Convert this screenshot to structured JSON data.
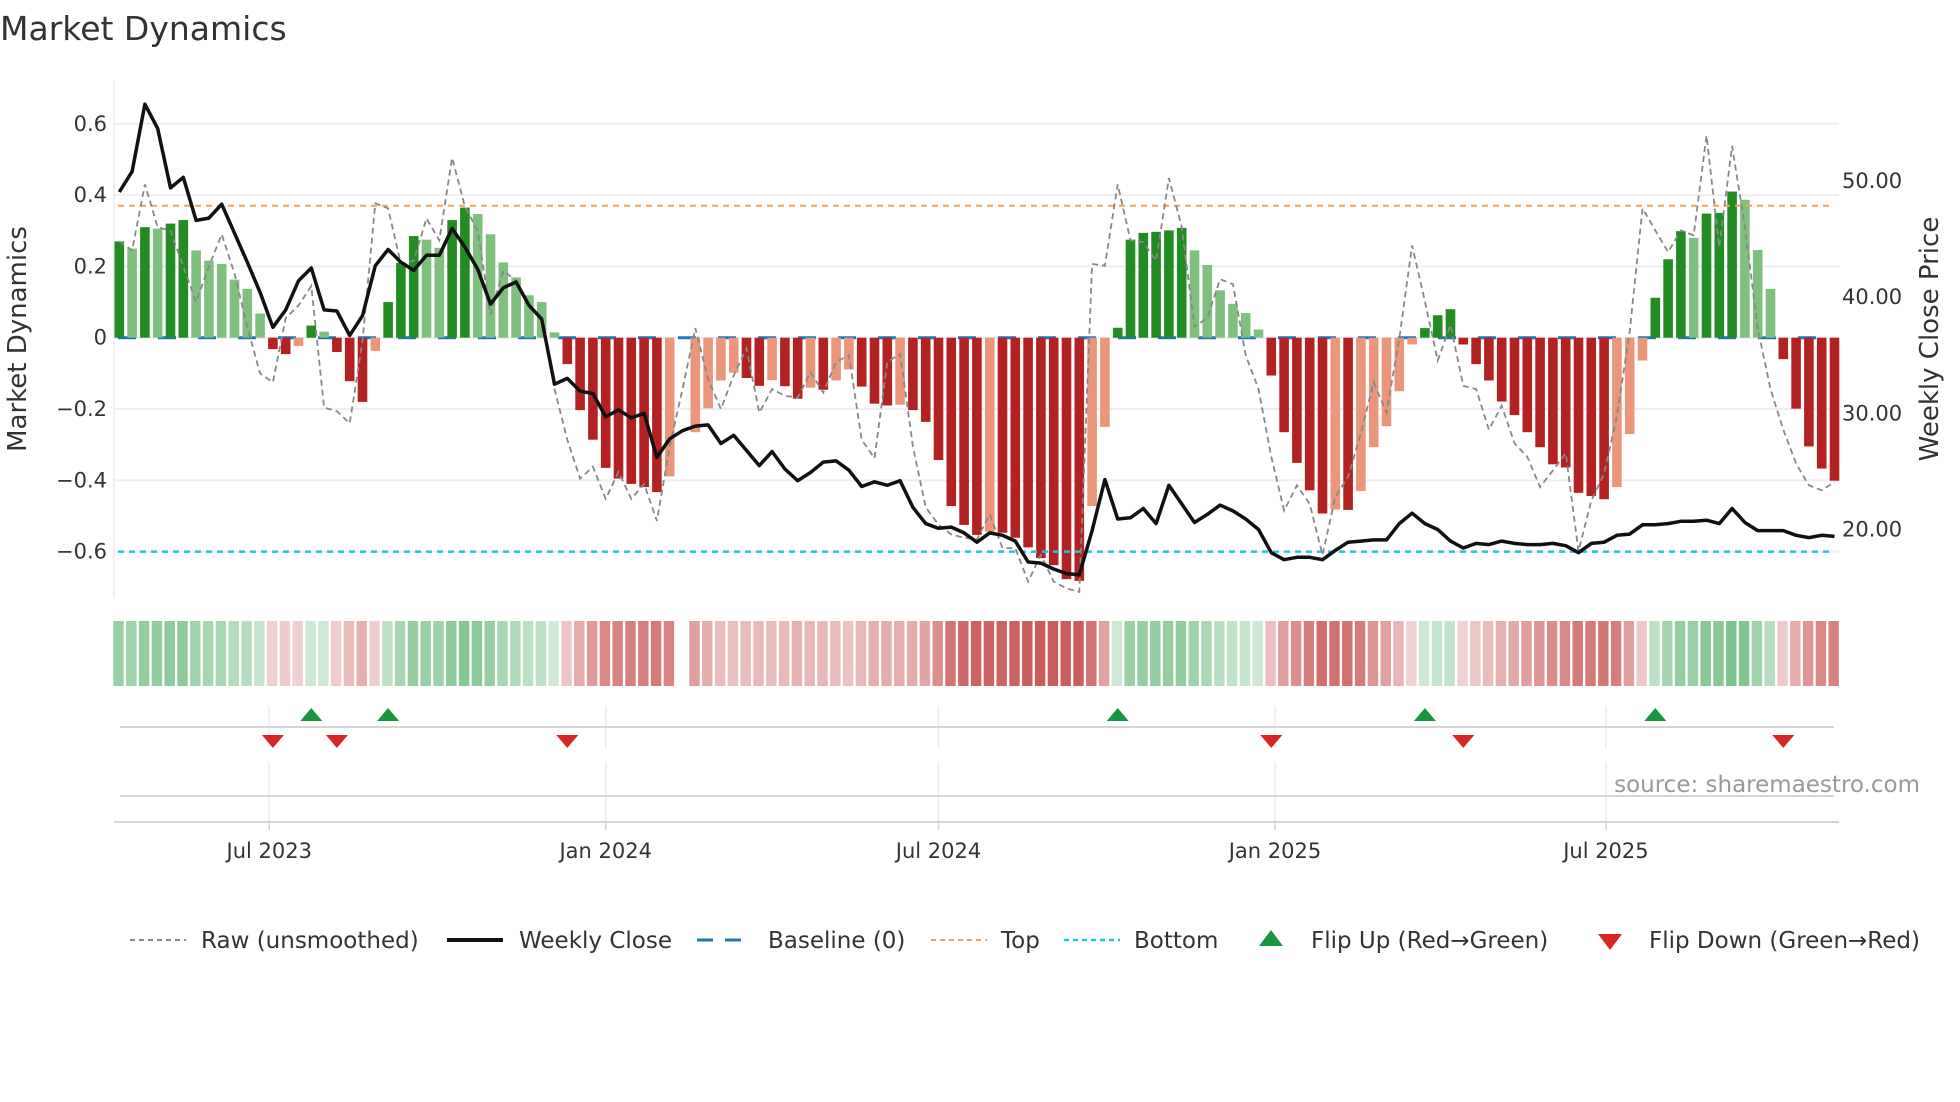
{
  "title": "Market Dynamics",
  "source": "source: sharemaestro.com",
  "colors": {
    "green_strong": "#228b22",
    "green_weak": "#7fc07f",
    "red_strong": "#b22222",
    "red_weak": "#e9967a",
    "price_line": "#111111",
    "raw_line": "#888888",
    "baseline": "#1f77b4",
    "top": "#f4a261",
    "bottom": "#22c4e0",
    "flip_up": "#1a9641",
    "flip_down": "#d62728",
    "grid": "#eceef3"
  },
  "chart_data": {
    "type": "bar",
    "title": "Market Dynamics",
    "ylabel": "Market Dynamics",
    "y2label": "Weekly Close Price",
    "ylim": [
      -0.73,
      0.72
    ],
    "y2lim": [
      14.1,
      58.6
    ],
    "yticks": [
      "0.6",
      "0.4",
      "0.2",
      "0",
      "−0.2",
      "−0.4",
      "−0.6"
    ],
    "ytick_values": [
      0.6,
      0.4,
      0.2,
      0,
      -0.2,
      -0.4,
      -0.6
    ],
    "y2ticks": [
      "50.00",
      "40.00",
      "30.00",
      "20.00"
    ],
    "y2tick_values": [
      50,
      40,
      30,
      20
    ],
    "xticks": [
      "Jul 2023",
      "Jan 2024",
      "Jul 2024",
      "Jan 2025",
      "Jul 2025"
    ],
    "xtick_dates": [
      "2023-07-01",
      "2024-01-01",
      "2024-07-01",
      "2025-01-01",
      "2025-07-01"
    ],
    "start_date": "2023-04-10",
    "interval_days": 7,
    "grid": true,
    "top_level": 0.37,
    "bottom_level": -0.6,
    "baseline": 0,
    "legend_position": "bottom",
    "legend": [
      "Raw (unsmoothed)",
      "Weekly Close",
      "Baseline (0)",
      "Top",
      "Bottom",
      "Flip Up (Red→Green)",
      "Flip Down (Green→Red)"
    ],
    "series": [
      {
        "name": "Market Dynamics (smoothed)",
        "values": [
          0.27,
          0.25,
          0.31,
          0.306,
          0.32,
          0.33,
          0.245,
          0.216,
          0.207,
          0.163,
          0.137,
          0.068,
          -0.032,
          -0.046,
          -0.023,
          0.034,
          0.017,
          -0.04,
          -0.122,
          -0.18,
          -0.037,
          0.1,
          0.21,
          0.285,
          0.275,
          0.252,
          0.33,
          0.365,
          0.347,
          0.29,
          0.211,
          0.169,
          0.119,
          0.1,
          0.015,
          -0.074,
          -0.203,
          -0.286,
          -0.365,
          -0.395,
          -0.41,
          -0.419,
          -0.433,
          -0.389,
          null,
          -0.265,
          -0.198,
          -0.12,
          -0.098,
          -0.113,
          -0.135,
          -0.119,
          -0.136,
          -0.171,
          -0.14,
          -0.146,
          -0.12,
          -0.089,
          -0.137,
          -0.185,
          -0.19,
          -0.188,
          -0.203,
          -0.236,
          -0.343,
          -0.472,
          -0.525,
          -0.553,
          -0.544,
          -0.547,
          -0.561,
          -0.588,
          -0.618,
          -0.638,
          -0.677,
          -0.682,
          -0.472,
          -0.25,
          0.028,
          0.275,
          0.294,
          0.297,
          0.301,
          0.308,
          0.245,
          0.204,
          0.133,
          0.095,
          0.069,
          0.023,
          -0.106,
          -0.265,
          -0.351,
          -0.428,
          -0.493,
          -0.482,
          -0.483,
          -0.43,
          -0.307,
          -0.248,
          -0.15,
          -0.019,
          0.027,
          0.063,
          0.08,
          -0.019,
          -0.074,
          -0.12,
          -0.179,
          -0.217,
          -0.265,
          -0.307,
          -0.355,
          -0.364,
          -0.435,
          -0.444,
          -0.453,
          -0.419,
          -0.27,
          -0.064,
          0.112,
          0.22,
          0.299,
          0.28,
          0.348,
          0.35,
          0.41,
          0.387,
          0.246,
          0.137,
          -0.06,
          -0.199,
          -0.305,
          -0.367,
          -0.401
        ]
      },
      {
        "name": "Raw (unsmoothed)",
        "values": [
          0.27,
          0.245,
          0.43,
          0.31,
          0.3,
          0.2,
          0.1,
          0.2,
          0.29,
          0.18,
          0.03,
          -0.1,
          -0.125,
          0.055,
          0.09,
          0.145,
          -0.196,
          -0.206,
          -0.24,
          -0.01,
          0.377,
          0.363,
          0.207,
          0.216,
          0.335,
          0.273,
          0.505,
          0.368,
          0.3,
          0.065,
          0.188,
          0.16,
          0.093,
          0.055,
          -0.144,
          -0.286,
          -0.395,
          -0.362,
          -0.452,
          -0.376,
          -0.452,
          -0.41,
          -0.514,
          -0.305,
          -0.144,
          0.027,
          -0.116,
          -0.2,
          -0.106,
          -0.03,
          -0.21,
          -0.144,
          -0.163,
          -0.168,
          -0.097,
          -0.154,
          -0.068,
          -0.049,
          -0.286,
          -0.338,
          -0.068,
          -0.045,
          -0.305,
          -0.476,
          -0.524,
          -0.552,
          -0.561,
          -0.566,
          -0.495,
          -0.59,
          -0.59,
          -0.684,
          -0.609,
          -0.684,
          -0.703,
          -0.713,
          0.207,
          0.202,
          0.43,
          0.273,
          0.268,
          0.216,
          0.448,
          0.311,
          0.031,
          0.055,
          0.164,
          0.15,
          -0.049,
          -0.144,
          -0.334,
          -0.485,
          -0.414,
          -0.466,
          -0.609,
          -0.447,
          -0.39,
          -0.267,
          -0.125,
          -0.21,
          -0.002,
          0.259,
          0.102,
          -0.064,
          0.036,
          -0.135,
          -0.144,
          -0.258,
          -0.191,
          -0.296,
          -0.334,
          -0.419,
          -0.372,
          -0.324,
          -0.599,
          -0.457,
          -0.381,
          -0.22,
          0.017,
          0.363,
          0.301,
          0.24,
          0.301,
          0.287,
          0.567,
          0.254,
          0.538,
          0.311,
          0.027,
          -0.144,
          -0.258,
          -0.353,
          -0.414,
          -0.428,
          -0.405
        ]
      },
      {
        "name": "Weekly Close",
        "axis": "right",
        "values": [
          49.05,
          50.8,
          56.6,
          54.5,
          49.4,
          50.3,
          46.6,
          46.8,
          48.0,
          45.5,
          43.0,
          40.4,
          37.4,
          38.9,
          41.4,
          42.5,
          38.9,
          38.8,
          36.7,
          38.4,
          42.7,
          44.1,
          43.0,
          42.3,
          43.6,
          43.6,
          45.9,
          44.3,
          42.4,
          39.4,
          40.8,
          41.3,
          39.3,
          38.1,
          32.5,
          33.0,
          31.9,
          31.7,
          29.7,
          30.3,
          29.6,
          30.0,
          26.2,
          27.8,
          28.5,
          28.9,
          29.0,
          27.4,
          28.1,
          26.8,
          25.5,
          26.7,
          25.2,
          24.2,
          24.9,
          25.8,
          25.9,
          25.1,
          23.7,
          24.1,
          23.8,
          24.2,
          21.9,
          20.5,
          20.1,
          20.2,
          19.7,
          18.9,
          19.7,
          19.5,
          19.0,
          17.2,
          17.1,
          16.6,
          16.2,
          16.1,
          19.9,
          24.3,
          20.9,
          21.0,
          21.8,
          20.5,
          23.8,
          22.2,
          20.6,
          21.3,
          22.1,
          21.6,
          20.9,
          20.0,
          18.0,
          17.4,
          17.6,
          17.6,
          17.4,
          18.2,
          18.9,
          19.0,
          19.1,
          19.1,
          20.5,
          21.4,
          20.5,
          20.0,
          19.0,
          18.4,
          18.8,
          18.7,
          19.0,
          18.8,
          18.7,
          18.7,
          18.8,
          18.6,
          18.0,
          18.8,
          18.9,
          19.5,
          19.6,
          20.4,
          20.4,
          20.5,
          20.7,
          20.7,
          20.8,
          20.5,
          21.8,
          20.6,
          19.9,
          19.9,
          19.9,
          19.5,
          19.3,
          19.5,
          19.4
        ]
      }
    ],
    "flip_up_weeks": [
      16,
      22,
      79,
      103,
      121
    ],
    "flip_down_weeks": [
      13,
      18,
      36,
      91,
      106,
      131
    ]
  }
}
